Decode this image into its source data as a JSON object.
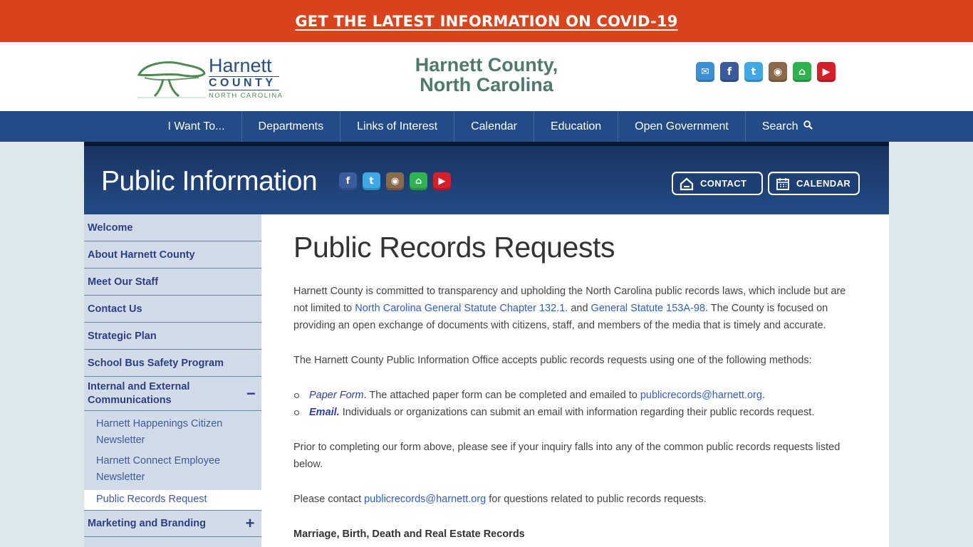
{
  "banner": {
    "text": "GET THE LATEST INFORMATION ON COVID-19"
  },
  "header": {
    "logo": {
      "harnett": "Harnett",
      "county": "COUNTY",
      "state": "NORTH CAROLINA"
    },
    "site_title_line1": "Harnett County,",
    "site_title_line2": "North Carolina",
    "social": [
      {
        "name": "email",
        "glyph": "✉",
        "color": "#3f8fd4"
      },
      {
        "name": "facebook",
        "glyph": "f",
        "color": "#3b5b9f"
      },
      {
        "name": "twitter",
        "glyph": "t",
        "color": "#3fa9e6"
      },
      {
        "name": "instagram",
        "glyph": "◉",
        "color": "#8a6a4a"
      },
      {
        "name": "nextdoor",
        "glyph": "⌂",
        "color": "#2fb34f"
      },
      {
        "name": "youtube",
        "glyph": "▶",
        "color": "#d3202b"
      }
    ]
  },
  "nav": {
    "items": [
      "I Want To...",
      "Departments",
      "Links of Interest",
      "Calendar",
      "Education",
      "Open Government",
      "Search"
    ]
  },
  "dept": {
    "title": "Public Information",
    "contact_label": "CONTACT",
    "calendar_label": "CALENDAR"
  },
  "sidebar": {
    "items_top": [
      "Welcome",
      "About Harnett County",
      "Meet Our Staff",
      "Contact Us",
      "Strategic Plan",
      "School Bus Safety Program"
    ],
    "expanded": {
      "label": "Internal and External Communications",
      "toggle": "−"
    },
    "sub_items": [
      "Harnett Happenings Citizen Newsletter",
      "Harnett Connect Employee Newsletter"
    ],
    "active_sub": "Public Records Request",
    "after": {
      "label": "Marketing and Branding",
      "toggle": "+"
    }
  },
  "main": {
    "title": "Public Records Requests",
    "p1_a": "Harnett County is committed to transparency and upholding the North Carolina public records laws, which include but are not limited to ",
    "p1_link1": "North Carolina General Statute Chapter 132.1.",
    "p1_b": " and ",
    "p1_link2": "General Statute 153A-98",
    "p1_c": ". The County is focused on providing an open exchange of documents with citizens, staff, and members of the media that is timely and accurate.",
    "p2": "The Harnett County Public Information Office accepts public records requests using one of the following methods:",
    "li1_link": "Paper Form",
    "li1_a": ". The attached paper form can be completed and emailed to ",
    "li1_email": "publicrecords@harnett.org",
    "li1_b": ".",
    "li2_link": "Email.",
    "li2_a": " Individuals or organizations can submit an email with information regarding their public records request.",
    "p3": "Prior to completing our form above, please see if your inquiry falls into any of the common public records requests listed below.",
    "p4_a": "Please contact ",
    "p4_email": "publicrecords@harnett.org",
    "p4_b": " for questions related to public records requests.",
    "subhead": "Marriage, Birth, Death and Real Estate Records"
  }
}
